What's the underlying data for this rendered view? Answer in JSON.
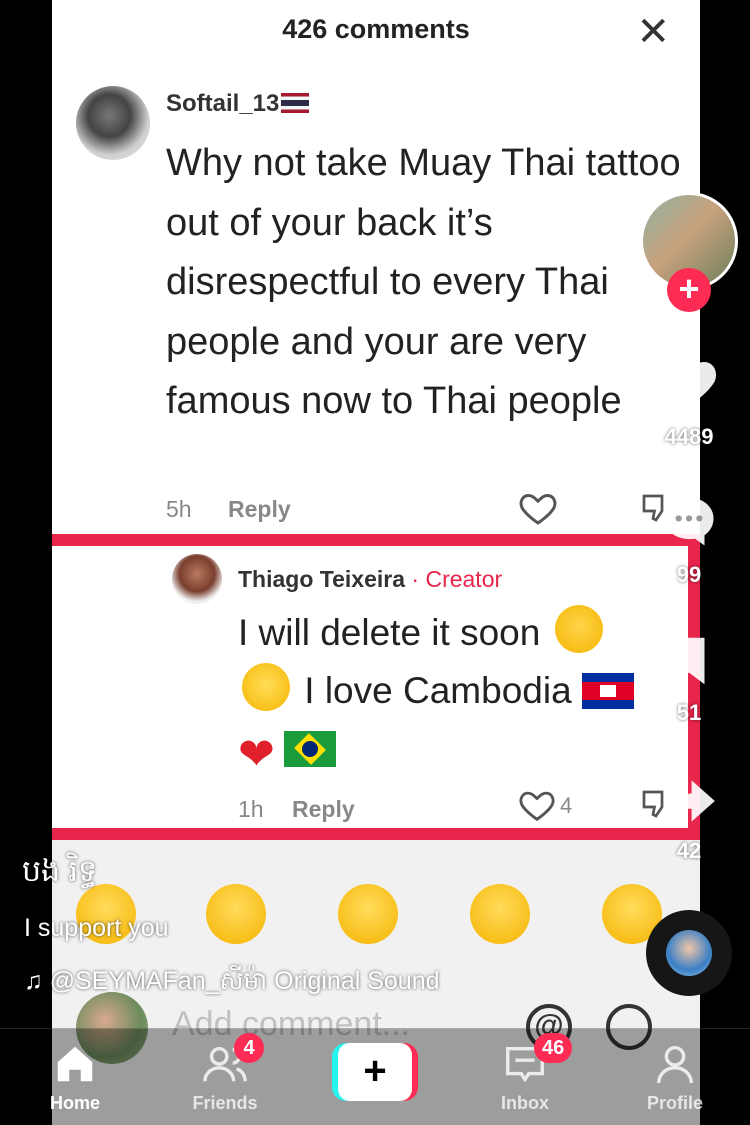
{
  "panel": {
    "title": "426 comments",
    "close_glyph": "✕"
  },
  "comment1": {
    "username": "Softail_13",
    "text": "Why not take Muay Thai tattoo out of your back it’s disrespectful to every Thai people and your are very famous now to Thai people",
    "time": "5h",
    "reply": "Reply"
  },
  "comment2": {
    "username": "Thiago Teixeira",
    "role": " · Creator",
    "text_line1": "I will delete it soon",
    "text_line2": "I love Cambodia",
    "time": "1h",
    "reply": "Reply",
    "likes": "4"
  },
  "add_comment": {
    "placeholder": "Add comment..."
  },
  "sidebar": {
    "likes": "4489",
    "comments": "99",
    "saves": "51",
    "shares": "42"
  },
  "caption": {
    "author": "បង រិទ្ធ",
    "description": "I support you",
    "sound": "♫ @SEYMAFan_សីម៉ា Original Sound"
  },
  "nav": {
    "home": "Home",
    "friends": "Friends",
    "friends_badge": "4",
    "create": "+",
    "inbox": "Inbox",
    "inbox_badge": "46",
    "profile": "Profile"
  },
  "colors": {
    "accent": "#fe2c55",
    "highlight_border": "#e8254b",
    "cyan": "#25f4ee"
  }
}
